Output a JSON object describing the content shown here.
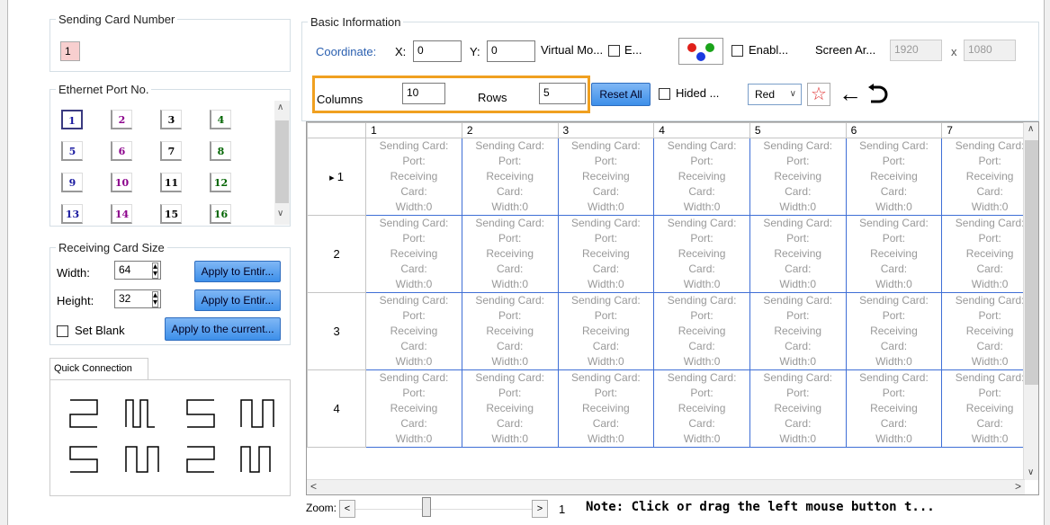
{
  "sending_card": {
    "legend": "Sending Card Number",
    "value": "1"
  },
  "ethernet": {
    "legend": "Ethernet Port No.",
    "ports": [
      "1",
      "2",
      "3",
      "4",
      "5",
      "6",
      "7",
      "8",
      "9",
      "10",
      "11",
      "12",
      "13",
      "14",
      "15",
      "16"
    ],
    "colors": [
      "#1a1aa0",
      "#8b008b",
      "#000000",
      "#006400"
    ]
  },
  "rcv_size": {
    "legend": "Receiving Card Size",
    "width_label": "Width:",
    "width_value": "64",
    "height_label": "Height:",
    "height_value": "32",
    "apply_entire_1": "Apply to Entir...",
    "apply_entire_2": "Apply to Entir...",
    "set_blank": "Set Blank",
    "apply_current": "Apply to the current..."
  },
  "quick": {
    "tab": "Quick Connection"
  },
  "basic": {
    "legend": "Basic Information",
    "coordinate": "Coordinate:",
    "x_label": "X:",
    "x_value": "0",
    "y_label": "Y:",
    "y_value": "0",
    "virtual": "Virtual Mo...",
    "e_label": "E...",
    "enable": "Enabl...",
    "screen_area": "Screen Ar...",
    "screen_w": "1920",
    "x_sep": "x",
    "screen_h": "1080",
    "columns_label": "Columns",
    "columns_value": "10",
    "rows_label": "Rows",
    "rows_value": "5",
    "reset_all": "Reset All",
    "hided": "Hided ...",
    "color_select": "Red",
    "highlight_color": "#f0a020"
  },
  "grid": {
    "col_headers": [
      "1",
      "2",
      "3",
      "4",
      "5",
      "6",
      "7"
    ],
    "row_headers": [
      "1",
      "2",
      "3",
      "4"
    ],
    "cell_lines": [
      "Sending Card:",
      "Port:",
      "Receiving",
      "Card:",
      "Width:0"
    ]
  },
  "zoom": {
    "label": "Zoom:",
    "left": "<",
    "right": ">",
    "level": "1",
    "note": "Note: Click or drag the left mouse button t..."
  }
}
